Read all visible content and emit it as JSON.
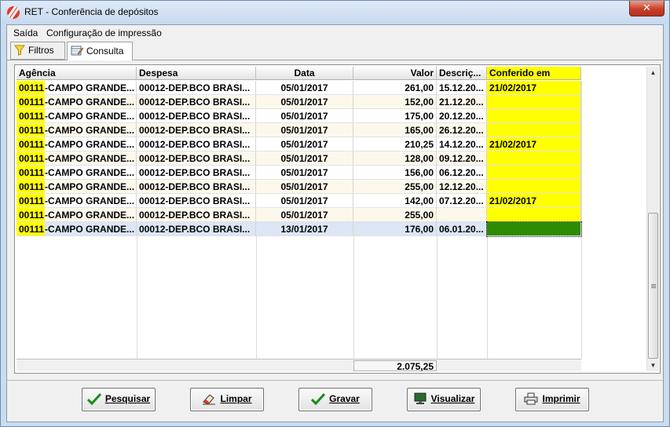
{
  "window": {
    "title": "RET - Conferência de depósitos",
    "close_glyph": "✕"
  },
  "menu": {
    "items": [
      "Saída",
      "Configuração de impressão"
    ]
  },
  "tabs": [
    {
      "label": "Filtros",
      "icon": "funnel-icon"
    },
    {
      "label": "Consulta",
      "icon": "edit-table-icon"
    }
  ],
  "grid": {
    "columns": [
      "Agência",
      "Despesa",
      "Data",
      "Valor",
      "Descriç...",
      "Conferido em"
    ],
    "rows": [
      {
        "agencia_code": "00111",
        "agencia_name": "-CAMPO GRANDE...",
        "despesa": "00012-DEP.BCO BRASI...",
        "data": "05/01/2017",
        "valor": "261,00",
        "descricao": "15.12.20...",
        "conferido": "21/02/2017"
      },
      {
        "agencia_code": "00111",
        "agencia_name": "-CAMPO GRANDE...",
        "despesa": "00012-DEP.BCO BRASI...",
        "data": "05/01/2017",
        "valor": "152,00",
        "descricao": "21.12.20...",
        "conferido": ""
      },
      {
        "agencia_code": "00111",
        "agencia_name": "-CAMPO GRANDE...",
        "despesa": "00012-DEP.BCO BRASI...",
        "data": "05/01/2017",
        "valor": "175,00",
        "descricao": "20.12.20...",
        "conferido": ""
      },
      {
        "agencia_code": "00111",
        "agencia_name": "-CAMPO GRANDE...",
        "despesa": "00012-DEP.BCO BRASI...",
        "data": "05/01/2017",
        "valor": "165,00",
        "descricao": "26.12.20...",
        "conferido": ""
      },
      {
        "agencia_code": "00111",
        "agencia_name": "-CAMPO GRANDE...",
        "despesa": "00012-DEP.BCO BRASI...",
        "data": "05/01/2017",
        "valor": "210,25",
        "descricao": "14.12.20...",
        "conferido": "21/02/2017"
      },
      {
        "agencia_code": "00111",
        "agencia_name": "-CAMPO GRANDE...",
        "despesa": "00012-DEP.BCO BRASI...",
        "data": "05/01/2017",
        "valor": "128,00",
        "descricao": "09.12.20...",
        "conferido": ""
      },
      {
        "agencia_code": "00111",
        "agencia_name": "-CAMPO GRANDE...",
        "despesa": "00012-DEP.BCO BRASI...",
        "data": "05/01/2017",
        "valor": "156,00",
        "descricao": "06.12.20...",
        "conferido": ""
      },
      {
        "agencia_code": "00111",
        "agencia_name": "-CAMPO GRANDE...",
        "despesa": "00012-DEP.BCO BRASI...",
        "data": "05/01/2017",
        "valor": "255,00",
        "descricao": "12.12.20...",
        "conferido": ""
      },
      {
        "agencia_code": "00111",
        "agencia_name": "-CAMPO GRANDE...",
        "despesa": "00012-DEP.BCO BRASI...",
        "data": "05/01/2017",
        "valor": "142,00",
        "descricao": "07.12.20...",
        "conferido": "21/02/2017"
      },
      {
        "agencia_code": "00111",
        "agencia_name": "-CAMPO GRANDE...",
        "despesa": "00012-DEP.BCO BRASI...",
        "data": "05/01/2017",
        "valor": "255,00",
        "descricao": "",
        "conferido": ""
      },
      {
        "agencia_code": "00111",
        "agencia_name": "-CAMPO GRANDE...",
        "despesa": "00012-DEP.BCO BRASI...",
        "data": "13/01/2017",
        "valor": "176,00",
        "descricao": "06.01.20...",
        "conferido": ""
      }
    ],
    "selected_row": 10,
    "total": "2.075,25"
  },
  "buttons": [
    {
      "label": "Pesquisar",
      "icon": "checkmark-icon"
    },
    {
      "label": "Limpar",
      "icon": "eraser-icon"
    },
    {
      "label": "Gravar",
      "icon": "checkmark-icon"
    },
    {
      "label": "Visualizar",
      "icon": "monitor-icon"
    },
    {
      "label": "Imprimir",
      "icon": "printer-icon"
    }
  ],
  "colors": {
    "highlight": "#ffff00",
    "row_alt": "#fdf8ec",
    "row_selected": "#dce6f4",
    "focused_cell": "#2e8b00",
    "ok_green": "#1a8a1a"
  }
}
